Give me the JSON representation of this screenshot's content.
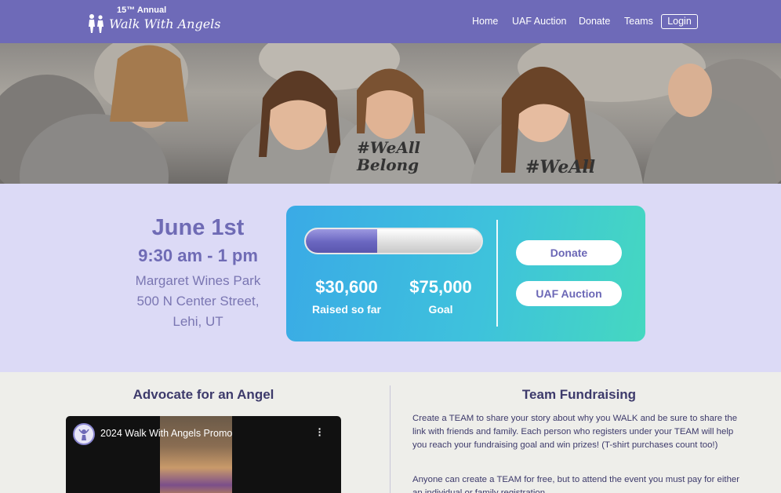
{
  "header": {
    "logo_top": "15™ Annual",
    "logo_main": "Walk With Angels",
    "nav": [
      "Home",
      "UAF Auction",
      "Donate",
      "Teams"
    ],
    "login_label": "Login"
  },
  "hero": {
    "shirt_text": "#We All Belong"
  },
  "event": {
    "date": "June 1st",
    "time": "9:30 am - 1 pm",
    "address_lines": [
      "Margaret Wines Park",
      "500 N Center Street,",
      "Lehi, UT"
    ]
  },
  "fundraising": {
    "raised": "$30,600",
    "raised_label": "Raised so far",
    "goal": "$75,000",
    "goal_label": "Goal",
    "progress_fraction": 0.408,
    "donate_label": "Donate",
    "auction_label": "UAF Auction"
  },
  "advocate": {
    "title": "Advocate for an Angel",
    "video_title": "2024 Walk With Angels Promo",
    "menu_icon": "more-vertical-icon"
  },
  "team": {
    "title": "Team Fundraising",
    "paragraph_1": "Create a TEAM to share your story about why you WALK and be sure to share the link with friends and family. Each person who registers under your TEAM will help you reach your fundraising goal and win prizes! (T-shirt purchases count too!)",
    "paragraph_2": "Anyone can create a TEAM for free, but to attend the event you must pay for either an individual or family registration."
  },
  "colors": {
    "header": "#6e6ab8",
    "band": "#dcdaf6",
    "accent_text": "#6f6bb5",
    "card_start": "#3aaae6",
    "card_end": "#45d8c0",
    "body_text": "#3d3a6b"
  }
}
